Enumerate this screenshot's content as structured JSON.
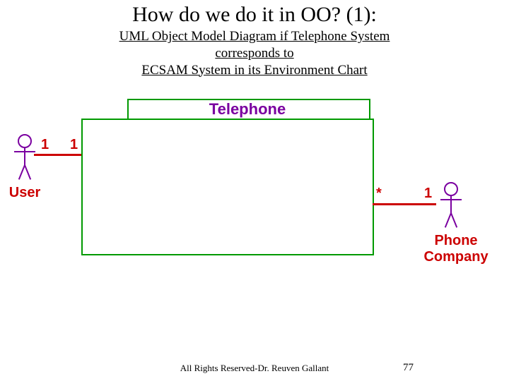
{
  "title": "How do we do it in OO? (1):",
  "subtitle": {
    "line1": "UML Object Model Diagram if Telephone System",
    "line2": "corresponds to",
    "line3": "ECSAM System in its Environment Chart"
  },
  "diagram": {
    "center_class_name": "Telephone",
    "left": {
      "actor_label": "User",
      "mult_near_actor": "1",
      "mult_near_box": "1"
    },
    "right": {
      "actor_label": "Phone\nCompany",
      "mult_near_box": "*",
      "mult_near_actor": "1"
    }
  },
  "footer": {
    "copyright": "All Rights Reserved-Dr. Reuven Gallant",
    "page": "77"
  }
}
